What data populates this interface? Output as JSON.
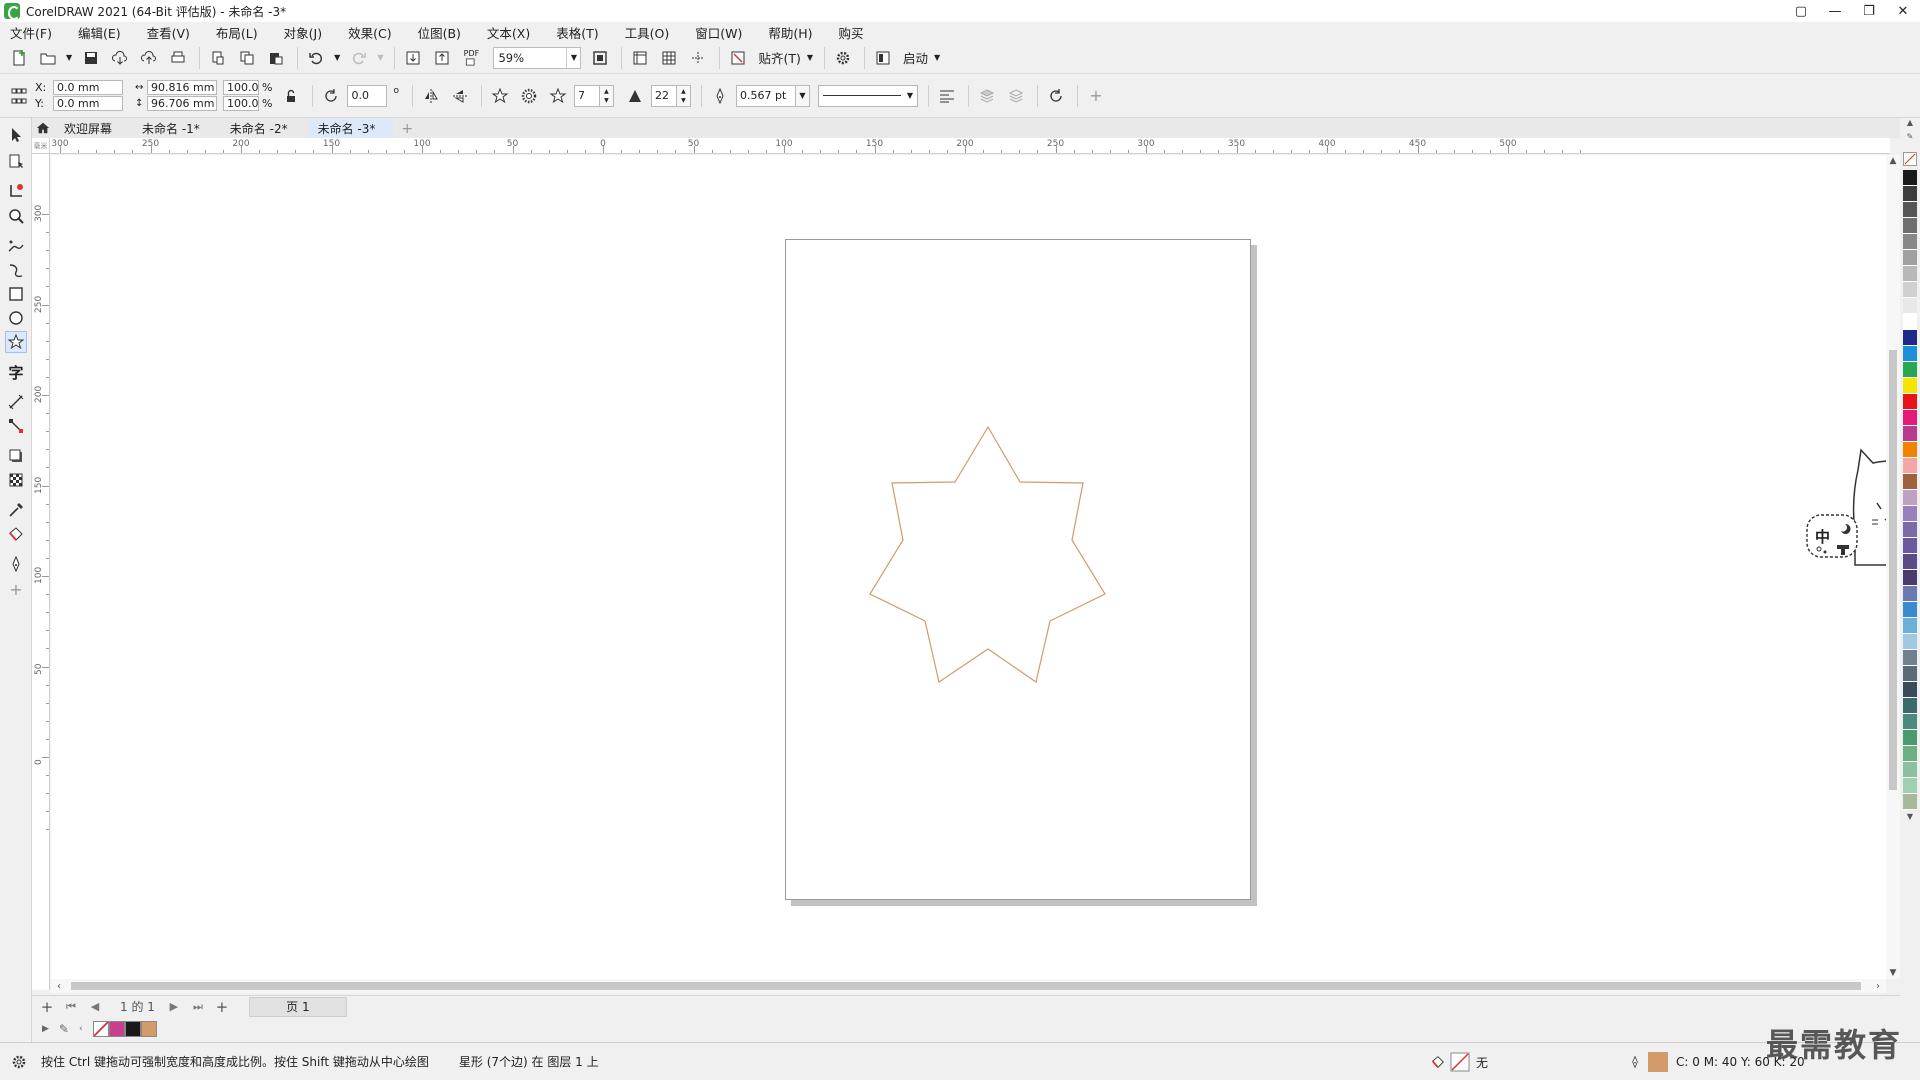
{
  "window": {
    "title": "CorelDRAW 2021 (64-Bit 评估版) - 未命名 -3*",
    "controls": [
      "▢",
      "—",
      "❐",
      "✕"
    ]
  },
  "menu": [
    "文件(F)",
    "编辑(E)",
    "查看(V)",
    "布局(L)",
    "对象(J)",
    "效果(C)",
    "位图(B)",
    "文本(X)",
    "表格(T)",
    "工具(O)",
    "窗口(W)",
    "帮助(H)",
    "购买"
  ],
  "toolbar": {
    "zoom": "59%",
    "snap_label": "贴齐(T)",
    "launch_label": "启动",
    "pdf_label": "PDF"
  },
  "property_bar": {
    "x_label": "X:",
    "y_label": "Y:",
    "x": "0.0 mm",
    "y": "0.0 mm",
    "width": "90.816 mm",
    "height": "96.706 mm",
    "scale_w": "100.0",
    "scale_h": "100.0",
    "pct": "%",
    "rotation": "0.0",
    "degree": "o",
    "points": "7",
    "sharpness": "22",
    "outline_width": "0.567 pt"
  },
  "tabs": {
    "welcome": "欢迎屏幕",
    "docs": [
      "未命名 -1*",
      "未命名 -2*",
      "未命名 -3*"
    ],
    "add": "+"
  },
  "ruler": {
    "corner": "毫米",
    "top_labels": [
      "300",
      "250",
      "200",
      "150",
      "100",
      "50",
      "0",
      "50",
      "100",
      "150",
      "200",
      "250",
      "300",
      "350",
      "400",
      "450",
      "500"
    ],
    "left_labels": [
      "300",
      "250",
      "200",
      "150",
      "100",
      "50",
      "0"
    ]
  },
  "page_nav": {
    "add": "+",
    "count": "1 的 1",
    "page_tab": "页 1"
  },
  "status": {
    "hint": "按住 Ctrl 键拖动可强制宽度和高度成比例。按住 Shift 键拖动从中心绘图",
    "object": "星形 (7个边) 在 图层 1 上",
    "fill": "无",
    "cmyk": "C: 0 M: 40 Y: 60 K: 20"
  },
  "mascot_text": "中",
  "watermark": "最需教育",
  "colors": {
    "star_outline": "#d39a6a",
    "active_tab": "#dbe9fa",
    "outline_chip": "#d39a6a"
  },
  "document_palette": [
    "none",
    "#c8408c",
    "#1a1a1a",
    "#d39a6a"
  ],
  "palette": [
    "#1a1a1a",
    "#3c3c3c",
    "#555555",
    "#6e6e6e",
    "#888888",
    "#a0a0a0",
    "#b8b8b8",
    "#d0d0d0",
    "#e8e8e8",
    "#ffffff",
    "#1d2a8c",
    "#1e90d8",
    "#27a850",
    "#f4e600",
    "#e8141c",
    "#e31c79",
    "#b83a8e",
    "#f08400",
    "#f4a6a6",
    "#a06040",
    "#c0a0c0",
    "#9b7fbd",
    "#7a6aa8",
    "#6a58a0",
    "#5a4a88",
    "#4a3a70",
    "#6a7ab0",
    "#3a8ad0",
    "#6ab0d8",
    "#a0c8e0",
    "#708090",
    "#5a6a7a",
    "#3a4a5a",
    "#3a6a6a",
    "#4a8a80",
    "#4a9a70",
    "#6ab080",
    "#8ac0a0",
    "#a0d0b0",
    "#a8b898"
  ]
}
